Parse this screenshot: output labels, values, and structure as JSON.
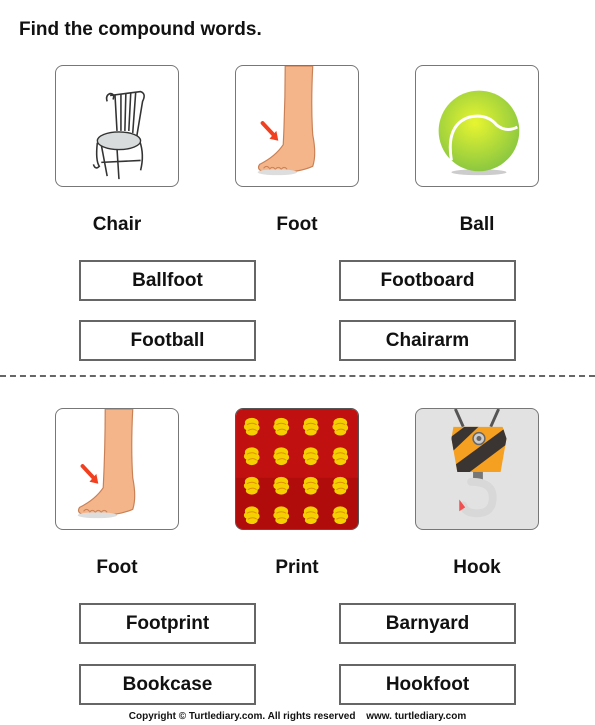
{
  "instruction": "Find the compound words.",
  "sections": [
    {
      "pictures": [
        {
          "label": "Chair",
          "icon": "chair-icon"
        },
        {
          "label": "Foot",
          "icon": "foot-icon"
        },
        {
          "label": "Ball",
          "icon": "tennis-ball-icon"
        }
      ],
      "options": [
        "Ballfoot",
        "Footboard",
        "Football",
        "Chairarm"
      ]
    },
    {
      "pictures": [
        {
          "label": "Foot",
          "icon": "foot-icon"
        },
        {
          "label": "Print",
          "icon": "print-pattern-icon"
        },
        {
          "label": "Hook",
          "icon": "crane-hook-icon"
        }
      ],
      "options": [
        "Footprint",
        "Barnyard",
        "Bookcase",
        "Hookfoot"
      ]
    }
  ],
  "footer": {
    "copyright": "Copyright © Turtlediary.com. All rights reserved",
    "website": "www. turtlediary.com"
  },
  "colors": {
    "option_border": "#666666",
    "print_background": "#c01010",
    "print_motif": "#f5d000",
    "ball_green": "#a8d830",
    "hook_stripe_orange": "#f5a020"
  }
}
